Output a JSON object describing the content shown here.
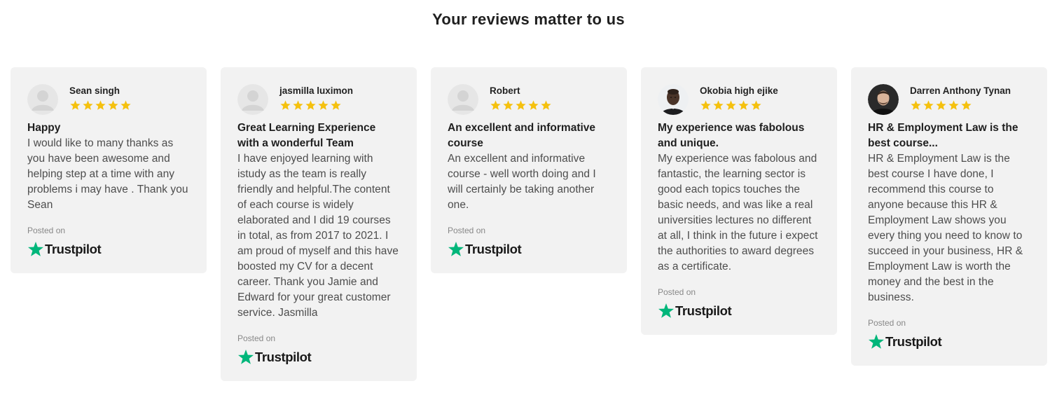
{
  "page": {
    "title": "Your reviews matter to us"
  },
  "colors": {
    "card_bg": "#f2f2f2",
    "star_fill": "#f5c10e",
    "trustpilot_green": "#00b67a"
  },
  "reviews": [
    {
      "name": "Sean singh",
      "rating": 5,
      "avatar": "placeholder-avatar-icon",
      "title": "Happy",
      "text": "I would like to many thanks as you have been awesome and helping step at a time with any problems i may have . Thank you Sean",
      "posted_on": "Posted on",
      "platform": "Trustpilot"
    },
    {
      "name": "jasmilla luximon",
      "rating": 5,
      "avatar": "placeholder-avatar-icon",
      "title": "Great Learning Experience with a wonderful Team",
      "text": "I have enjoyed learning with istudy as the team is really friendly and helpful.The content of each course is widely elaborated and I did 19 courses in total, as from 2017 to 2021. I am proud of myself and this have boosted my CV for a decent career. Thank you Jamie and Edward for your great customer service. Jasmilla",
      "posted_on": "Posted on",
      "platform": "Trustpilot"
    },
    {
      "name": "Robert",
      "rating": 5,
      "avatar": "placeholder-avatar-icon",
      "title": "An excellent and informative course",
      "text": "An excellent and informative course - well worth doing and I will certainly be taking another one.",
      "posted_on": "Posted on",
      "platform": "Trustpilot"
    },
    {
      "name": "Okobia high ejike",
      "rating": 5,
      "avatar": "photo-avatar",
      "title": "My experience was fabolous and unique.",
      "text": "My experience was fabolous and fantastic, the learning sector is good each topics touches the basic needs, and was like a real universities lectures no different at all, I think in the future i expect the authorities to award degrees as a certificate.",
      "posted_on": "Posted on",
      "platform": "Trustpilot"
    },
    {
      "name": "Darren Anthony Tynan",
      "rating": 5,
      "avatar": "photo-avatar",
      "title": "HR & Employment Law is the best course...",
      "text": "HR & Employment Law is the best course I have done, I recommend this course to anyone because this HR & Employment Law shows you every thing you need to know to succeed in your business, HR & Employment Law is worth the money and the best in the business.",
      "posted_on": "Posted on",
      "platform": "Trustpilot"
    }
  ]
}
